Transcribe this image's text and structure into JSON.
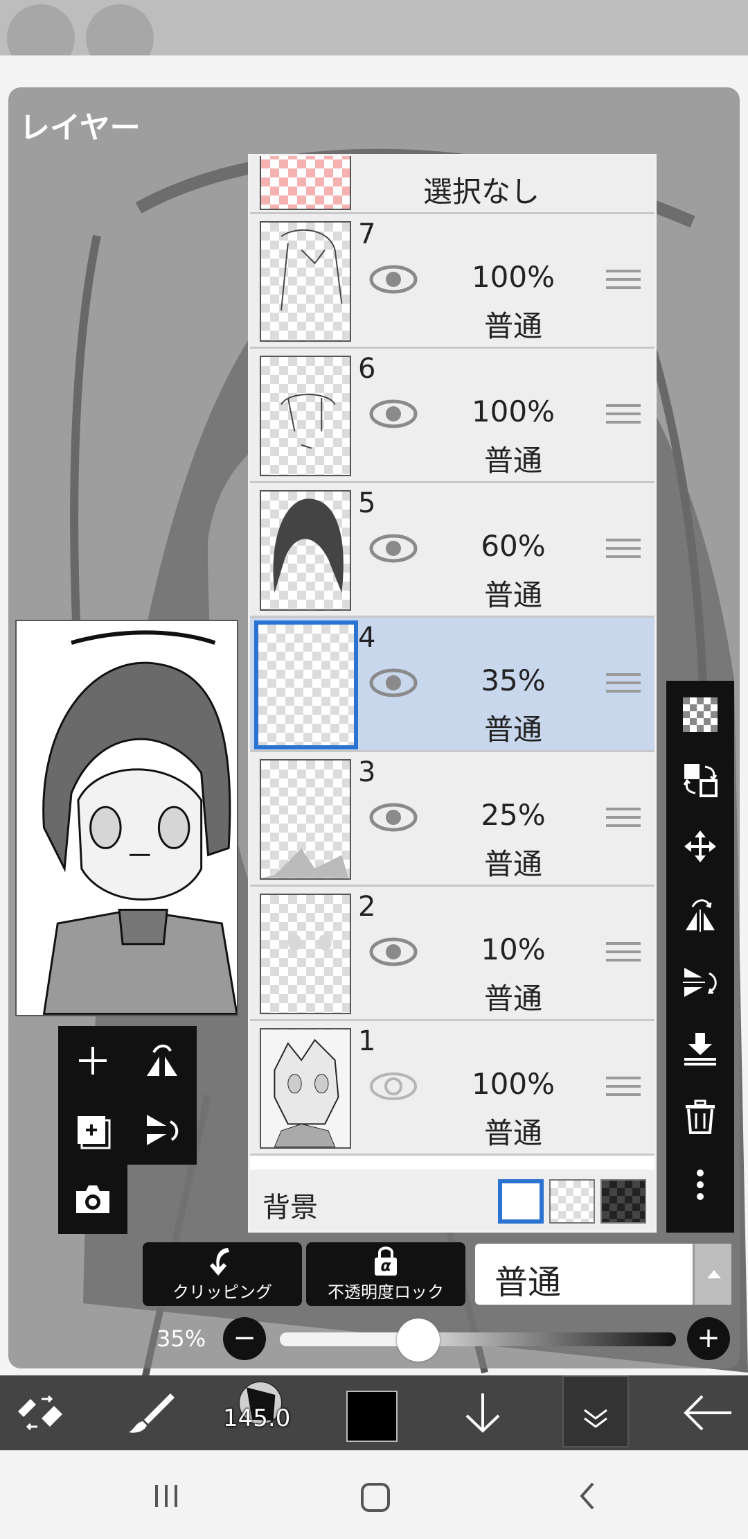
{
  "panel": {
    "title": "レイヤー"
  },
  "selection_row": {
    "label": "選択なし"
  },
  "layers": [
    {
      "number": "7",
      "opacity": "100%",
      "blend": "普通",
      "visible": true
    },
    {
      "number": "6",
      "opacity": "100%",
      "blend": "普通",
      "visible": true
    },
    {
      "number": "5",
      "opacity": "60%",
      "blend": "普通",
      "visible": true
    },
    {
      "number": "4",
      "opacity": "35%",
      "blend": "普通",
      "visible": true,
      "selected": true
    },
    {
      "number": "3",
      "opacity": "25%",
      "blend": "普通",
      "visible": true
    },
    {
      "number": "2",
      "opacity": "10%",
      "blend": "普通",
      "visible": true
    },
    {
      "number": "1",
      "opacity": "100%",
      "blend": "普通",
      "visible": false
    }
  ],
  "background_row": {
    "label": "背景"
  },
  "controls": {
    "clipping_label": "クリッピング",
    "alpha_lock_label": "不透明度ロック",
    "alpha_glyph": "α",
    "blend_mode_value": "普通",
    "opacity_value": "35%",
    "opacity_level": 0.35,
    "minus_symbol": "−",
    "plus_symbol": "+"
  },
  "toolbar": {
    "brush_size": "145.0"
  },
  "colors": {
    "selected_row": "#c8d7ec",
    "selection_border": "#2a73d0",
    "toolbar_dark": "#111111"
  }
}
